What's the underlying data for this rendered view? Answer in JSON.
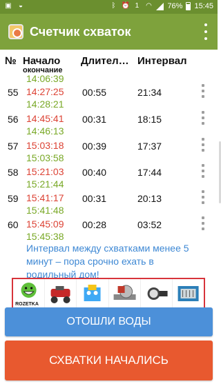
{
  "status_bar": {
    "battery": "76%",
    "time": "15:45",
    "sim_label": "1"
  },
  "app": {
    "title": "Счетчик схваток"
  },
  "table": {
    "headers": {
      "number": "№",
      "start": "Начало",
      "end": "окончание",
      "duration": "Длител…",
      "interval": "Интервал"
    },
    "previous_end": "14:06:39",
    "rows": [
      {
        "num": "55",
        "start": "14:27:25",
        "end": "14:28:21",
        "duration": "00:55",
        "interval": "21:34"
      },
      {
        "num": "56",
        "start": "14:45:41",
        "end": "14:46:13",
        "duration": "00:31",
        "interval": "18:15"
      },
      {
        "num": "57",
        "start": "15:03:18",
        "end": "15:03:58",
        "duration": "00:39",
        "interval": "17:37"
      },
      {
        "num": "58",
        "start": "15:21:03",
        "end": "15:21:44",
        "duration": "00:40",
        "interval": "17:44"
      },
      {
        "num": "59",
        "start": "15:41:17",
        "end": "15:41:48",
        "duration": "00:31",
        "interval": "20:13"
      },
      {
        "num": "60",
        "start": "15:45:09",
        "end": "15:45:38",
        "duration": "00:28",
        "interval": "03:52"
      }
    ]
  },
  "message": "Интервал между схватками менее 5 минут – пора срочно ехать в родильный дом!",
  "ads": {
    "brand": "ROZETKA"
  },
  "buttons": {
    "water": "ОТОШЛИ ВОДЫ",
    "start": "СХВАТКИ НАЧАЛИСЬ"
  },
  "colors": {
    "appbar": "#7ea23c",
    "start_time": "#dc4133",
    "end_time": "#78a825",
    "message": "#3e88d4",
    "water_button": "#4c90d9",
    "start_button": "#e8592f"
  }
}
